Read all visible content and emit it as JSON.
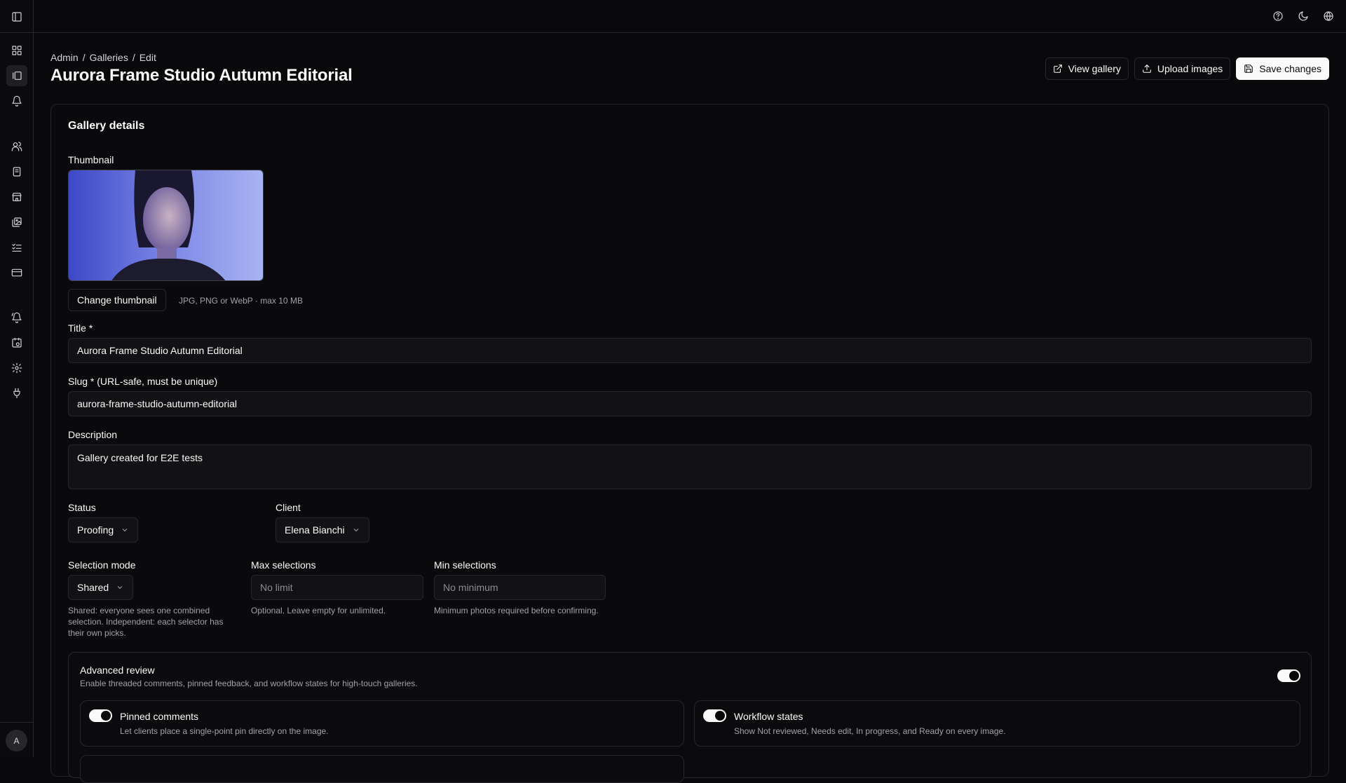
{
  "breadcrumb": [
    "Admin",
    "/",
    "Galleries",
    "/",
    "Edit"
  ],
  "page_title": "Aurora Frame Studio Autumn Editorial",
  "actions": {
    "view_gallery": "View gallery",
    "upload_images": "Upload images",
    "save_changes": "Save changes"
  },
  "sidebar": {
    "toggle_icon": "sidebar-toggle-icon",
    "items": [
      "dashboard",
      "galleries",
      "notifications",
      "clients",
      "invoices",
      "store",
      "photos",
      "tasks",
      "payments",
      "alerts",
      "calendar",
      "settings",
      "integrations"
    ],
    "avatar": "A"
  },
  "topbar_icons": [
    "help-icon",
    "moon-icon",
    "globe-icon"
  ],
  "card": {
    "title": "Gallery details",
    "thumbnail_label": "Thumbnail",
    "change_thumbnail": "Change thumbnail",
    "thumbnail_hint": "JPG, PNG or WebP · max 10 MB",
    "title_label": "Title *",
    "title_value": "Aurora Frame Studio Autumn Editorial",
    "slug_label": "Slug * (URL-safe, must be unique)",
    "slug_value": "aurora-frame-studio-autumn-editorial",
    "description_label": "Description",
    "description_value": "Gallery created for E2E tests",
    "status_label": "Status",
    "status_value": "Proofing",
    "client_label": "Client",
    "client_value": "Elena Bianchi",
    "selection_mode_label": "Selection mode",
    "selection_mode_value": "Shared",
    "selection_mode_hint": "Shared: everyone sees one combined selection. Independent: each selector has their own picks.",
    "max_selections_label": "Max selections",
    "max_selections_placeholder": "No limit",
    "max_selections_hint": "Optional. Leave empty for unlimited.",
    "min_selections_label": "Min selections",
    "min_selections_placeholder": "No minimum",
    "min_selections_hint": "Minimum photos required before confirming."
  },
  "advanced_review": {
    "title": "Advanced review",
    "description": "Enable threaded comments, pinned feedback, and workflow states for high-touch galleries.",
    "enabled": true,
    "pinned_comments": {
      "title": "Pinned comments",
      "description": "Let clients place a single-point pin directly on the image.",
      "enabled": true
    },
    "workflow_states": {
      "title": "Workflow states",
      "description": "Show Not reviewed, Needs edit, In progress, and Ready on every image.",
      "enabled": true
    }
  },
  "colors": {
    "background": "#09090b",
    "border": "#27272a",
    "primary": "#fafafa",
    "muted": "#a1a1aa"
  }
}
